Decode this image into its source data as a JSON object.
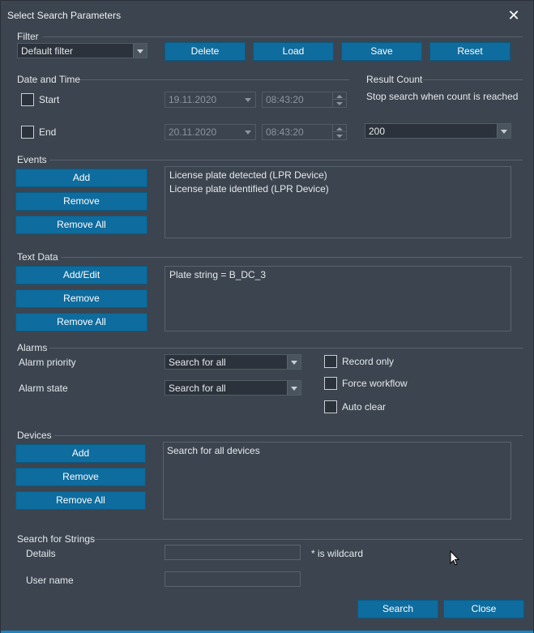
{
  "window": {
    "title": "Select Search Parameters"
  },
  "filter": {
    "heading": "Filter",
    "selected": "Default filter",
    "buttons": {
      "delete": "Delete",
      "load": "Load",
      "save": "Save",
      "reset": "Reset"
    }
  },
  "date_time": {
    "heading": "Date and Time",
    "start_label": "Start",
    "start_date": "19.11.2020",
    "start_time": "08:43:20",
    "end_label": "End",
    "end_date": "20.11.2020",
    "end_time": "08:43:20"
  },
  "result_count": {
    "heading": "Result Count",
    "description": "Stop search when count is reached",
    "value": "200"
  },
  "events": {
    "heading": "Events",
    "add": "Add",
    "remove": "Remove",
    "remove_all": "Remove All",
    "items": [
      "License plate detected (LPR Device)",
      "License plate identified (LPR Device)"
    ]
  },
  "text_data": {
    "heading": "Text Data",
    "add_edit": "Add/Edit",
    "remove": "Remove",
    "remove_all": "Remove All",
    "items": [
      "Plate string = B_DC_3"
    ]
  },
  "alarms": {
    "heading": "Alarms",
    "priority_label": "Alarm priority",
    "priority_value": "Search for all",
    "state_label": "Alarm state",
    "state_value": "Search for all",
    "record_only": "Record only",
    "force_workflow": "Force workflow",
    "auto_clear": "Auto clear"
  },
  "devices": {
    "heading": "Devices",
    "add": "Add",
    "remove": "Remove",
    "remove_all": "Remove All",
    "items": [
      "Search for all devices"
    ]
  },
  "search_strings": {
    "heading": "Search for Strings",
    "details_label": "Details",
    "details_value": "",
    "wildcard_note": "* is wildcard",
    "username_label": "User name",
    "username_value": ""
  },
  "footer": {
    "search": "Search",
    "close": "Close"
  },
  "colors": {
    "background": "#3b444f",
    "button": "#0e6c9e",
    "accent_strip": "#1a84c2"
  }
}
